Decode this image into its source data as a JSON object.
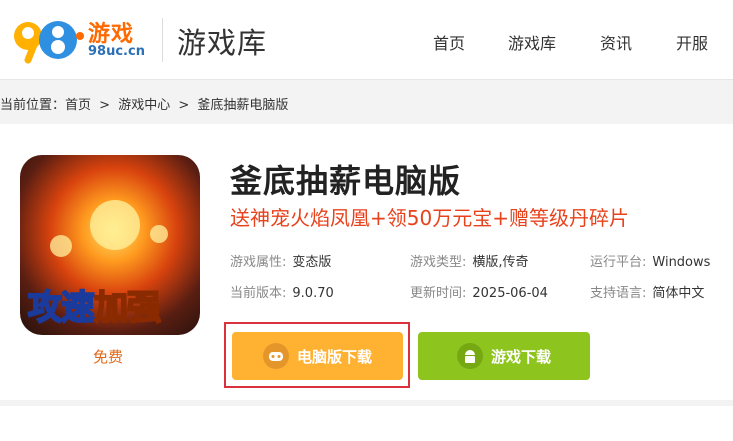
{
  "header": {
    "logo_name": "游戏",
    "logo_domain": "98uc.cn",
    "section_title": "游戏库",
    "nav": [
      "首页",
      "游戏库",
      "资讯",
      "开服"
    ]
  },
  "breadcrumb": {
    "prefix": "当前位置：",
    "items": [
      "首页",
      ">",
      "游戏中心",
      ">",
      "釜底抽薪电脑版"
    ]
  },
  "game": {
    "title": "釜底抽薪电脑版",
    "subtitle": "送神宠火焰凤凰+领50万元宝+赠等级丹碎片",
    "icon_text_1": "攻速",
    "icon_text_2": "加强",
    "price_label": "免费",
    "attributes": [
      {
        "key": "游戏属性:",
        "value": "变态版"
      },
      {
        "key": "游戏类型:",
        "value": "横版,传奇"
      },
      {
        "key": "运行平台:",
        "value": "Windows"
      },
      {
        "key": "当前版本:",
        "value": "9.0.70"
      },
      {
        "key": "更新时间:",
        "value": "2025-06-04"
      },
      {
        "key": "支持语言:",
        "value": "简体中文"
      }
    ]
  },
  "buttons": {
    "pc_download": "电脑版下载",
    "android_download": "游戏下载"
  },
  "colors": {
    "brand_orange": "#ff6a00",
    "pc_button": "#ffb132",
    "android_button": "#8ec41e",
    "subtitle_red": "#e8421c",
    "highlight_border": "#d9323c"
  }
}
